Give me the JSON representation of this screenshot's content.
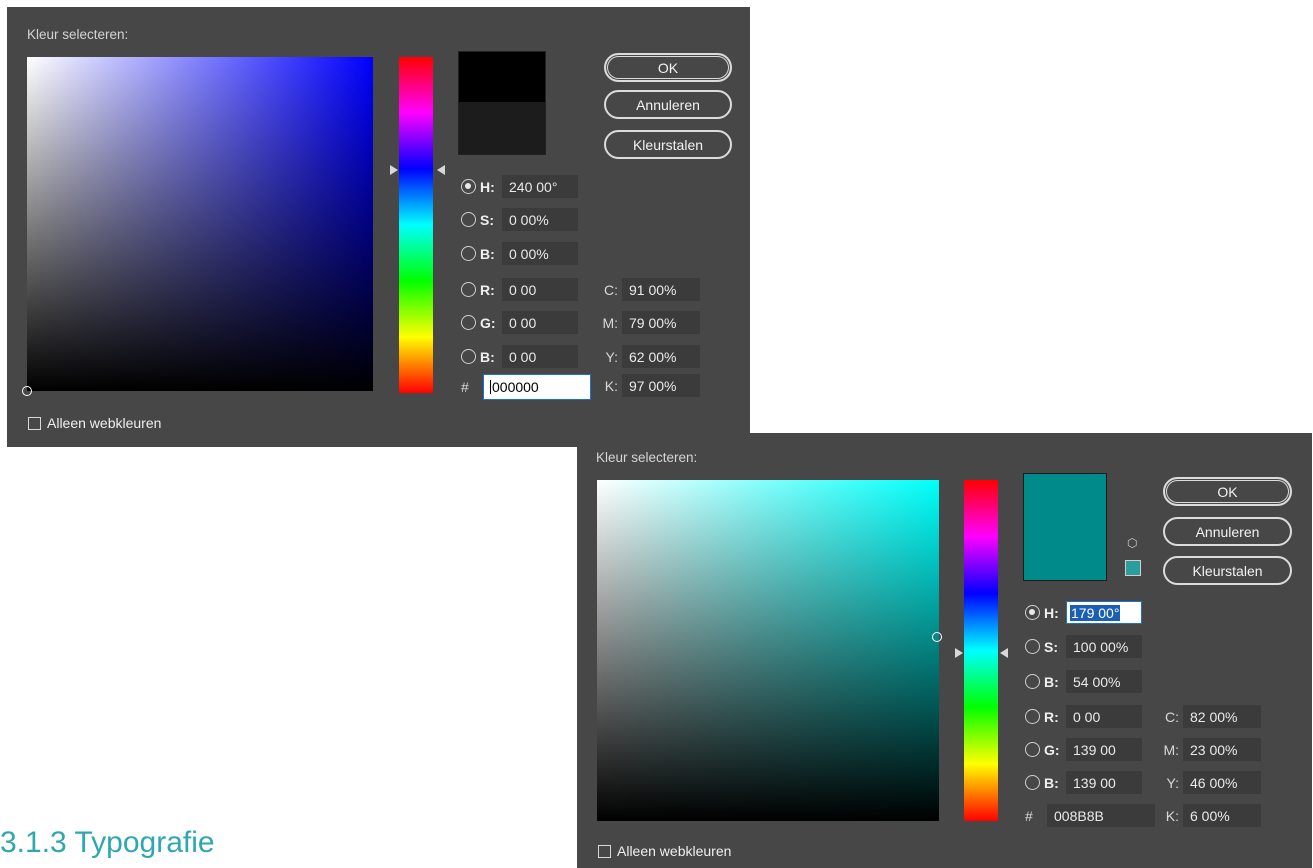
{
  "heading": "3.1.3 Typografie",
  "dialog1": {
    "title": "Kleur selecteren:",
    "hue_color": "#0000ff",
    "new_color": "#000000",
    "current_color": "#1c1c1c",
    "buttons": {
      "ok": "OK",
      "cancel": "Annuleren",
      "swatches": "Kleurstalen"
    },
    "labels": {
      "h": "H:",
      "s": "S:",
      "b": "B:",
      "r": "R:",
      "g": "G:",
      "b2": "B:",
      "hash": "#",
      "c": "C:",
      "m": "M:",
      "y": "Y:",
      "k": "K:"
    },
    "values": {
      "h": "240 00°",
      "s": "0 00%",
      "b": "0 00%",
      "r": "0 00",
      "g": "0 00",
      "b2": "0 00",
      "hex": "000000",
      "c": "91 00%",
      "m": "79 00%",
      "y": "62 00%",
      "k": "97 00%"
    },
    "webonly": "Alleen webkleuren"
  },
  "dialog2": {
    "title": "Kleur selecteren:",
    "hue_color": "#00fffb",
    "new_color": "#008b8b",
    "web_color": "#2a9d9d",
    "buttons": {
      "ok": "OK",
      "cancel": "Annuleren",
      "swatches": "Kleurstalen"
    },
    "labels": {
      "h": "H:",
      "s": "S:",
      "b": "B:",
      "r": "R:",
      "g": "G:",
      "b2": "B:",
      "hash": "#",
      "c": "C:",
      "m": "M:",
      "y": "Y:",
      "k": "K:"
    },
    "values": {
      "h": "179 00°",
      "s": "100 00%",
      "b": "54 00%",
      "r": "0 00",
      "g": "139 00",
      "b2": "139 00",
      "hex": "008B8B",
      "c": "82 00%",
      "m": "23 00%",
      "y": "46 00%",
      "k": "6 00%"
    },
    "webonly": "Alleen webkleuren"
  }
}
